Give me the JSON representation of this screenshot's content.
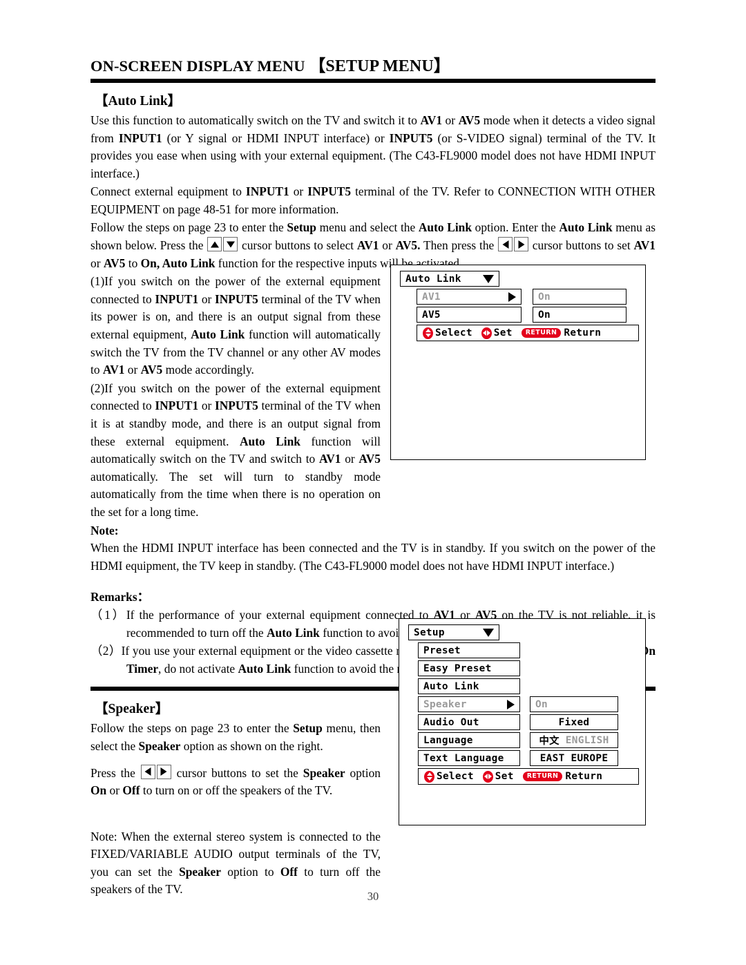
{
  "document": {
    "title_main": "ON-SCREEN DISPLAY MENU",
    "title_bracketed": "【SETUP MENU】",
    "page_number": "30"
  },
  "auto_link_section": {
    "heading": "【Auto Link】",
    "paragraphs": {
      "p1_a": "Use this function to automatically switch on the TV and switch it to ",
      "p1_b": "AV1",
      "p1_c": " or ",
      "p1_d": "AV5",
      "p1_e": " mode when it detects a video signal from ",
      "p1_f": "INPUT1",
      "p1_g": " (or Y signal or HDMI INPUT interface) or ",
      "p1_h": "INPUT5",
      "p1_i": " (or S-VIDEO signal) terminal of the TV. It provides you ease when using with your external equipment. (The C43-FL9000 model does not have HDMI INPUT interface.)",
      "p2_a": "Connect external equipment to ",
      "p2_b": "INPUT1",
      "p2_c": " or ",
      "p2_d": "INPUT5",
      "p2_e": " terminal of the TV. Refer to CONNECTION WITH OTHER EQUIPMENT on page 48-51 for more information.",
      "p3_a": "Follow the steps on page 23 to enter the ",
      "p3_b": "Setup",
      "p3_c": " menu and select the ",
      "p3_d": "Auto Link",
      "p3_e": " option. Enter the ",
      "p3_f": "Auto Link",
      "p3_g": " menu as shown below. Press the ",
      "p3_h": " cursor buttons to select ",
      "p3_i": "AV1",
      "p3_j": " or ",
      "p3_k": "AV5.",
      "p3_l": " Then press the ",
      "p3_m": " cursor buttons to set ",
      "p3_n": "AV1",
      "p3_o": " or ",
      "p3_p": "AV5",
      "p3_q": " to ",
      "p3_r": "On, Auto Link",
      "p3_s": " function for the respective inputs will be activated.",
      "item1_a": "(1)If you switch on the power of the external equipment connected to ",
      "item1_b": "INPUT1",
      "item1_c": " or ",
      "item1_d": "INPUT5",
      "item1_e": " terminal of the TV when its power is on, and there is an output signal from these external equipment, ",
      "item1_f": "Auto Link",
      "item1_g": " function will automatically switch the TV from the TV channel or any other AV modes to ",
      "item1_h": "AV1",
      "item1_i": " or ",
      "item1_j": "AV5",
      "item1_k": " mode accordingly.",
      "item2_a": "(2)If you switch on the power of the external equipment connected to ",
      "item2_b": "INPUT1",
      "item2_c": " or ",
      "item2_d": "INPUT5",
      "item2_e": " terminal of the TV when it is at standby mode, and there is an output signal from these external equipment. ",
      "item2_f": "Auto Link",
      "item2_g": " function will automatically switch on the TV and switch to ",
      "item2_h": "AV1",
      "item2_i": " or ",
      "item2_j": "AV5",
      "item2_k": " automatically. The set will turn to standby mode automatically from the time when there is no operation on the set for a long time."
    },
    "note_label": "Note:",
    "note_text": "When the HDMI INPUT interface has been connected and the TV is in standby. If you switch on the power of the HDMI equipment, the TV keep in standby. (The C43-FL9000 model does not have HDMI INPUT interface.)",
    "remarks_label": "Remarks：",
    "remarks": {
      "r1_num": "（1）",
      "r1_a": "If the performance of your external equipment connected to ",
      "r1_b": "AV1",
      "r1_c": " or ",
      "r1_d": "AV5",
      "r1_e": " on the TV is not reliable, it is recommended to turn off the ",
      "r1_f": "Auto Link",
      "r1_g": " function to avoid the misoperation.",
      "r2_num": "（2）",
      "r2_a": "If you use your external equipment or the video cassette recorder to perform recording after they are set to ",
      "r2_b": "On Timer",
      "r2_c": ", do not activate ",
      "r2_d": "Auto Link",
      "r2_e": " function to avoid the misoperation."
    }
  },
  "speaker_section": {
    "heading": "【Speaker】",
    "p1_a": "Follow the steps on page 23 to enter the ",
    "p1_b": "Setup",
    "p1_c": " menu, then select the ",
    "p1_d": "Speaker",
    "p1_e": " option as shown on the right.",
    "p2_a": "Press the ",
    "p2_b": " cursor buttons to set the ",
    "p2_c": "Speaker",
    "p2_d": " option ",
    "p2_e": "On",
    "p2_f": " or ",
    "p2_g": "Off",
    "p2_h": " to turn on or off the speakers of the TV.",
    "p3_a": "Note: When the external stereo system is connected to the FIXED/VARIABLE AUDIO output terminals of the TV, you can set the ",
    "p3_b": "Speaker",
    "p3_c": " option to ",
    "p3_d": "Off",
    "p3_e": " to turn off the speakers of the TV."
  },
  "osd_auto_link": {
    "header": "Auto Link",
    "rows": [
      {
        "label": "AV1",
        "value": "On",
        "selected": true
      },
      {
        "label": "AV5",
        "value": "On",
        "selected": false
      }
    ],
    "footer": {
      "select": "Select",
      "set": "Set",
      "return_badge": "RETURN",
      "return_label": "Return"
    }
  },
  "osd_setup": {
    "header": "Setup",
    "items": [
      {
        "label": "Preset",
        "value": ""
      },
      {
        "label": "Easy Preset",
        "value": ""
      },
      {
        "label": "Auto Link",
        "value": ""
      },
      {
        "label": "Speaker",
        "value": "On",
        "selected": true
      },
      {
        "label": "Audio Out",
        "value": "Fixed"
      },
      {
        "label": "Language",
        "value_cjk": "中文",
        "value_dim": "ENGLISH"
      },
      {
        "label": "Text Language",
        "value": "EAST EUROPE"
      }
    ],
    "footer": {
      "select": "Select",
      "set": "Set",
      "return_badge": "RETURN",
      "return_label": "Return"
    }
  },
  "colors": {
    "osd_accent": "#e3001b",
    "osd_dim": "#9a9a9a",
    "rule": "#000000"
  }
}
